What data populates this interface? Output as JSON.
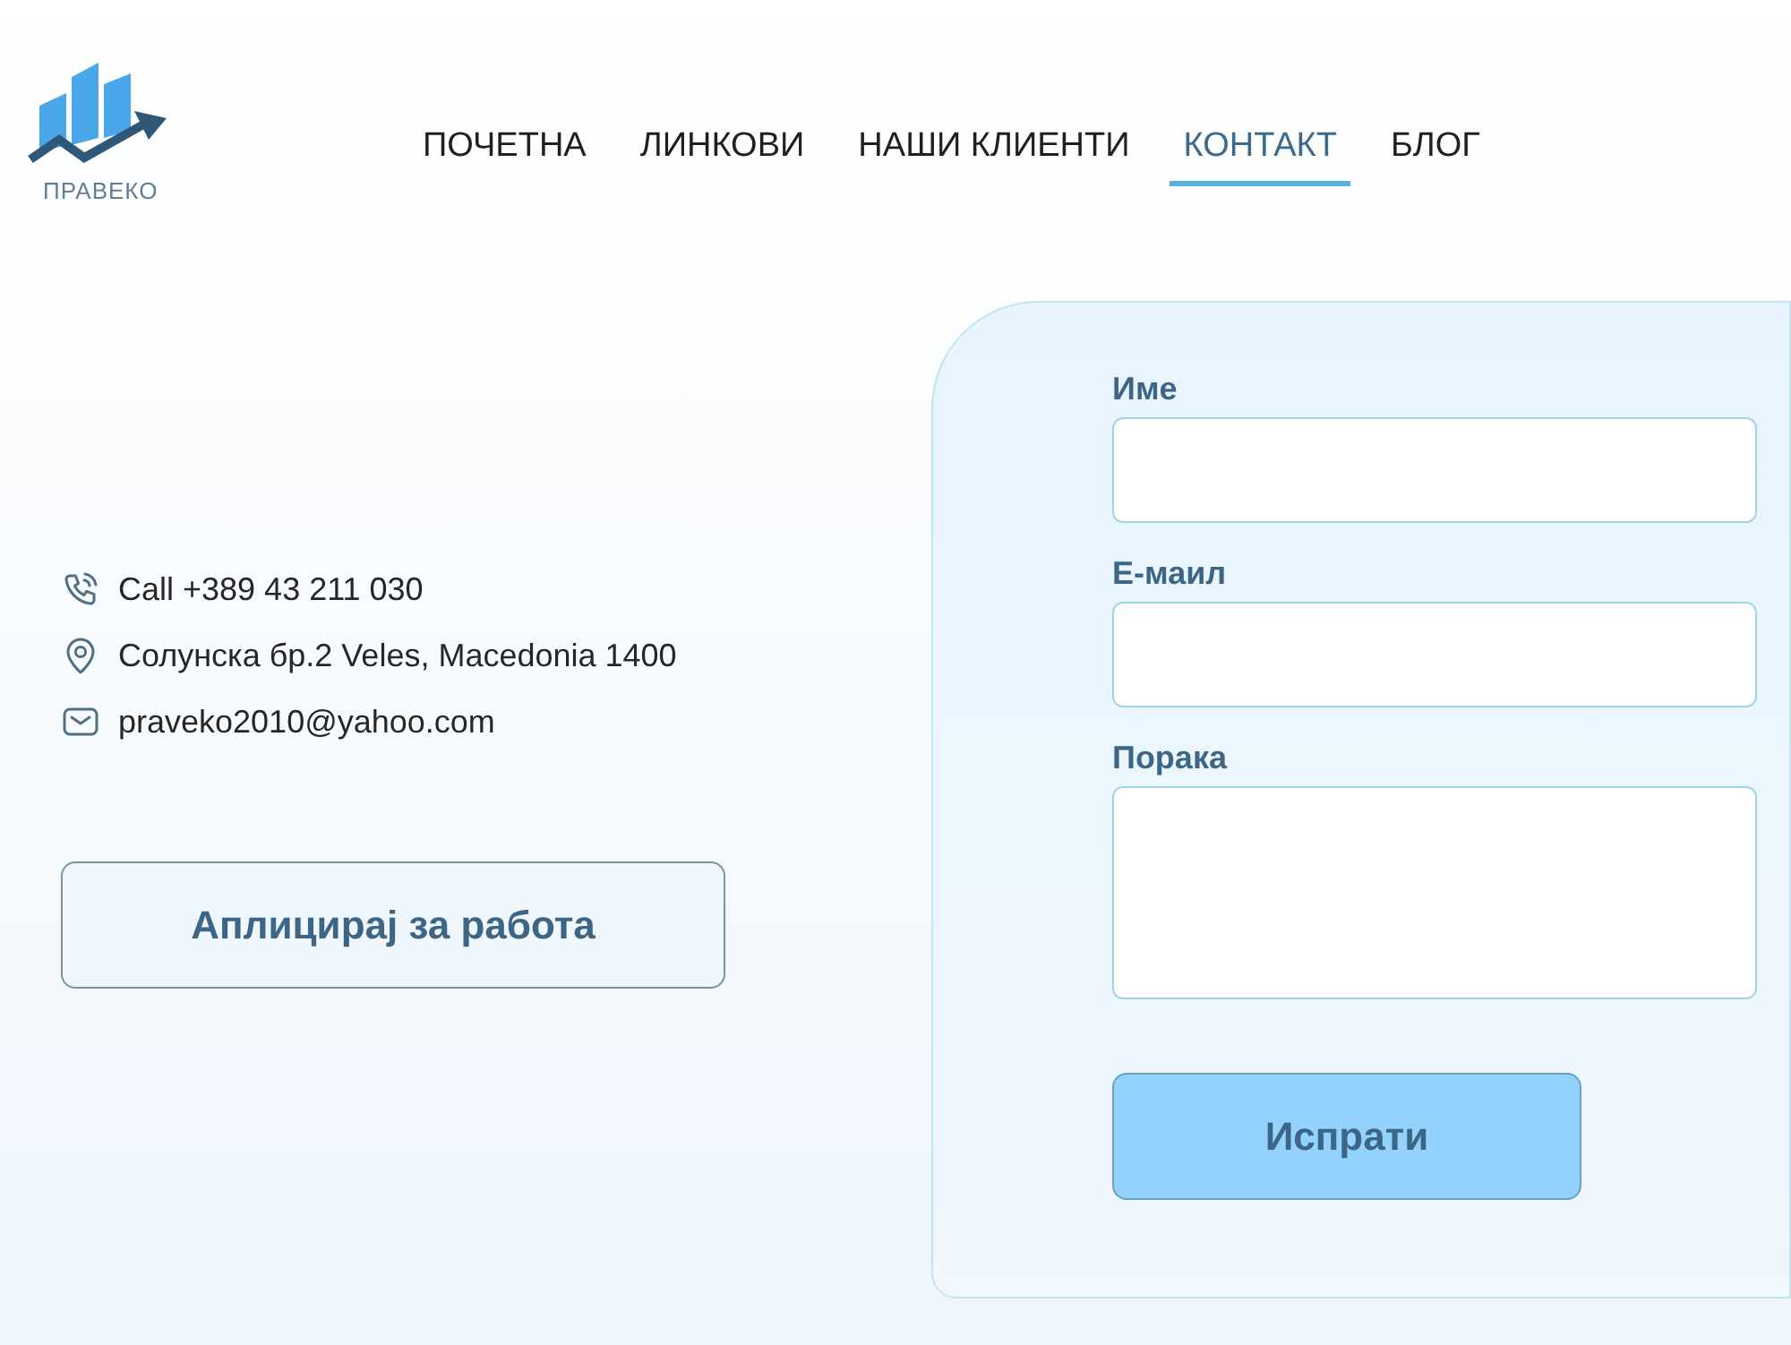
{
  "logo": {
    "text": "ПРАВЕКО"
  },
  "nav": [
    {
      "label": "ПОЧЕТНА",
      "selected": false
    },
    {
      "label": "ЛИНКОВИ",
      "selected": false
    },
    {
      "label": "НАШИ КЛИЕНТИ",
      "selected": false
    },
    {
      "label": "КОНТАКТ",
      "selected": true
    },
    {
      "label": "БЛОГ",
      "selected": false
    }
  ],
  "contact": [
    {
      "kind": "phone",
      "text": "Call +389 43 211 030"
    },
    {
      "kind": "location",
      "text": "Солунска бр.2 Veles, Macedonia 1400"
    },
    {
      "kind": "email",
      "text": "praveko2010@yahoo.com"
    }
  ],
  "apply_button": "Аплицирај за работа",
  "form": {
    "fields": [
      {
        "kind": "input",
        "label": "Име"
      },
      {
        "kind": "input",
        "label": "Е-маил"
      },
      {
        "kind": "textarea",
        "label": "Порака"
      }
    ],
    "submit": "Испрати"
  }
}
